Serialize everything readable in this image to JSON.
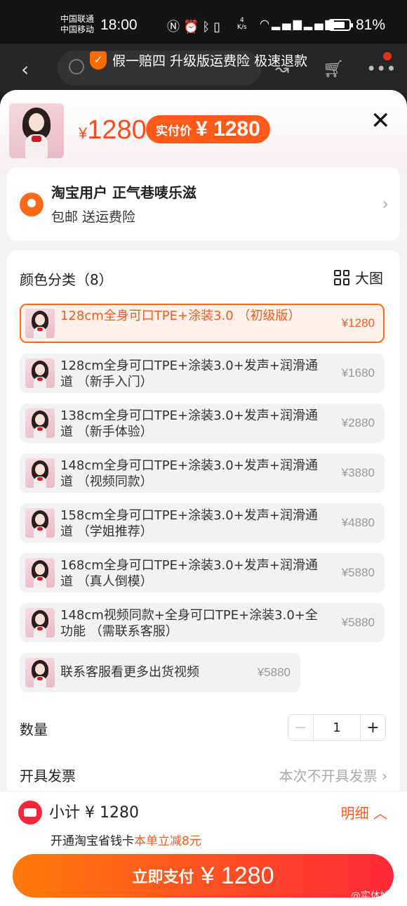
{
  "status_bar": {
    "carrier1": "中国联通",
    "carrier2": "中国移动",
    "time": "18:00",
    "net_speed_value": "4",
    "net_speed_unit": "K/s",
    "battery_percent": 81,
    "battery_text": "81%"
  },
  "page_header": {
    "banner": "假一赔四 升级版运费险 极速退款"
  },
  "product": {
    "price_symbol": "¥",
    "price": "1280",
    "paid_label": "实付价",
    "paid_value": "¥ 1280"
  },
  "address": {
    "name": "淘宝用户 正气巷唛乐滋",
    "sub": "包邮  送运费险"
  },
  "options": {
    "title": "颜色分类（8）",
    "big_view": "大图",
    "items": [
      {
        "name": "128cm全身可口TPE+涂装3.0 （初级版）",
        "price": "¥1280"
      },
      {
        "name": "128cm全身可口TPE+涂装3.0+发声+润滑通道 （新手入门）",
        "price": "¥1680"
      },
      {
        "name": "138cm全身可口TPE+涂装3.0+发声+润滑通道 （新手体验）",
        "price": "¥2880"
      },
      {
        "name": "148cm全身可口TPE+涂装3.0+发声+润滑通道 （视频同款）",
        "price": "¥3880"
      },
      {
        "name": "158cm全身可口TPE+涂装3.0+发声+润滑通道 （学姐推荐）",
        "price": "¥4880"
      },
      {
        "name": "168cm全身可口TPE+涂装3.0+发声+润滑通道 （真人倒模）",
        "price": "¥5880"
      },
      {
        "name": "148cm视频同款+全身可口TPE+涂装3.0+全功能 （需联系客服）",
        "price": "¥5880"
      },
      {
        "name": "联系客服看更多出货视频",
        "price": "¥5880"
      }
    ]
  },
  "quantity": {
    "label": "数量",
    "minus": "−",
    "value": "1",
    "plus": "+"
  },
  "invoice": {
    "label": "开具发票",
    "value": "本次不开具发票"
  },
  "footer": {
    "subtotal": "小计 ¥ 1280",
    "detail": "明细",
    "savecard_text": "开通淘宝省钱卡",
    "savecard_highlight": "本单立减8元",
    "pay_label": "立即支付",
    "pay_value": "¥ 1280",
    "watermark": "@实体娃娃"
  }
}
